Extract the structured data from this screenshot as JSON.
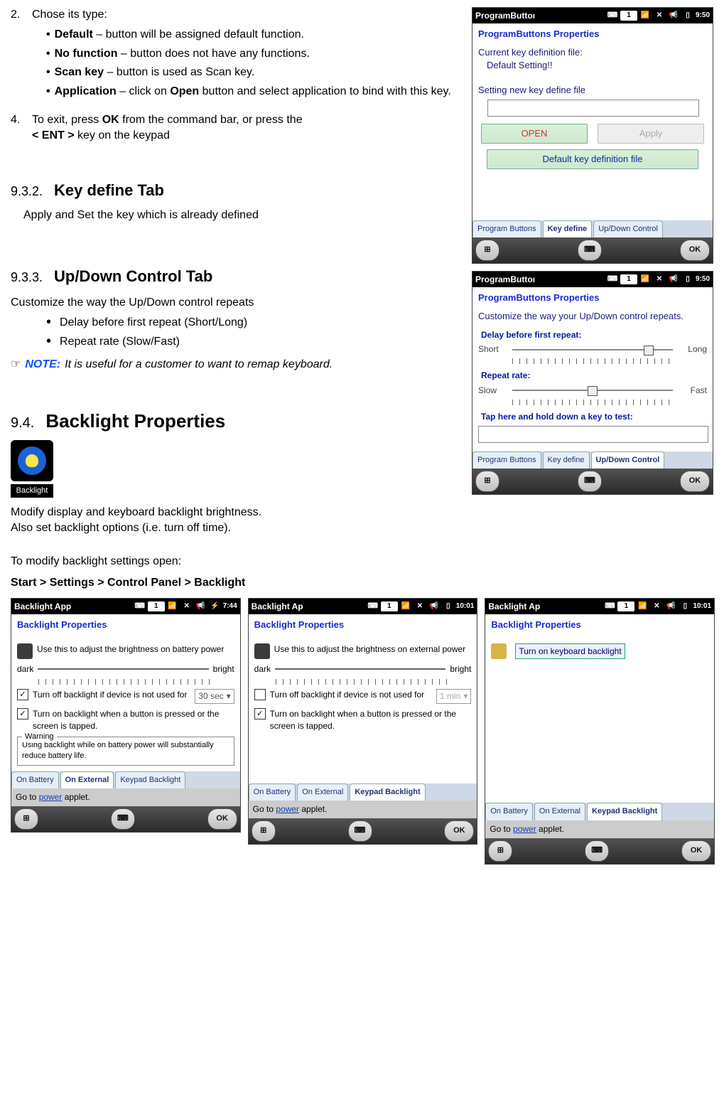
{
  "step2": {
    "num": "2.",
    "text": "Chose its type:",
    "items": [
      {
        "term": "Default",
        "desc": " – button will be assigned default function."
      },
      {
        "term": "No function",
        "desc": " – button does not have any functions."
      },
      {
        "term": "Scan key",
        "desc": " – button is used as Scan key."
      },
      {
        "term": "Application",
        "desc": " – click on ",
        "term2": "Open",
        "desc2": " button and select application to bind with this key."
      }
    ]
  },
  "step4": {
    "num": "4.",
    "part1": "To exit, press ",
    "bold1": "OK",
    "part2": " from the command bar, or press the ",
    "bold2": "< ENT >",
    "part3": " key on the keypad"
  },
  "sec932": {
    "num": "9.3.2.",
    "title": "Key define Tab",
    "body": "Apply and Set the key which is already defined"
  },
  "sec933": {
    "num": "9.3.3.",
    "title": "Up/Down Control Tab",
    "body": "Customize the way the Up/Down control repeats",
    "b1": "Delay before first repeat (Short/Long)",
    "b2": "Repeat rate (Slow/Fast)",
    "note": "It is useful for a customer to want to remap keyboard."
  },
  "sec94": {
    "num": "9.4.",
    "title": "Backlight Properties",
    "icon_label": "Backlight",
    "p1": "Modify display and keyboard backlight brightness.",
    "p2": "Also set backlight options (i.e. turn off time).",
    "p3": "To modify backlight settings open:",
    "path": "Start > Settings > Control Panel > Backlight"
  },
  "screens": {
    "kd": {
      "title": "ProgramButtoı",
      "badge": "1",
      "time": "9:50",
      "heading": "ProgramButtons Properties",
      "l1": "Current key definition file:",
      "l2": "Default Setting!!",
      "l3": "Setting new key define file",
      "btn_open": "OPEN",
      "btn_apply": "Apply",
      "btn_def": "Default key definition file",
      "tabs": [
        "Program Buttons",
        "Key define",
        "Up/Down Control"
      ],
      "ok": "OK"
    },
    "ud": {
      "title": "ProgramButtoı",
      "badge": "1",
      "time": "9:50",
      "heading": "ProgramButtons Properties",
      "l1": "Customize the way your Up/Down control repeats.",
      "h1": "Delay before first repeat:",
      "short": "Short",
      "long": "Long",
      "h2": "Repeat rate:",
      "slow": "Slow",
      "fast": "Fast",
      "test": "Tap here and hold down a key to test:",
      "tabs": [
        "Program Buttons",
        "Key define",
        "Up/Down Control"
      ],
      "ok": "OK"
    }
  },
  "bl": {
    "s1": {
      "title": "Backlight App",
      "badge": "1",
      "time": "7:44",
      "heading": "Backlight Properties",
      "l1": "Use this to adjust the brightness on battery power",
      "dark": "dark",
      "bright": "bright",
      "c1": "Turn off backlight if device is not used for",
      "sel": "30 sec",
      "c2": "Turn on backlight when a button is pressed or the screen is tapped.",
      "warn_t": "Warning",
      "warn": "Using backlight while on battery power will substantially reduce battery life.",
      "tabs": [
        "On Battery",
        "On External",
        "Keypad Backlight"
      ],
      "foot1": "Go to ",
      "link": "power",
      "foot2": " applet.",
      "ok": "OK"
    },
    "s2": {
      "title": "Backlight Ap",
      "badge": "1",
      "time": "10:01",
      "heading": "Backlight Properties",
      "l1": "Use this to adjust the brightness on external power",
      "dark": "dark",
      "bright": "bright",
      "c1": "Turn off backlight if device is not used for",
      "sel": "1 min",
      "c2": "Turn on backlight when a button is pressed or the screen is tapped.",
      "tabs": [
        "On Battery",
        "On External",
        "Keypad Backlight"
      ],
      "foot1": "Go to ",
      "link": "power",
      "foot2": " applet.",
      "ok": "OK"
    },
    "s3": {
      "title": "Backlight Ap",
      "badge": "1",
      "time": "10:01",
      "heading": "Backlight Properties",
      "c1": "Turn on keyboard backlight",
      "tabs": [
        "On Battery",
        "On External",
        "Keypad Backlight"
      ],
      "foot1": "Go to ",
      "link": "power",
      "foot2": " applet.",
      "ok": "OK"
    }
  }
}
